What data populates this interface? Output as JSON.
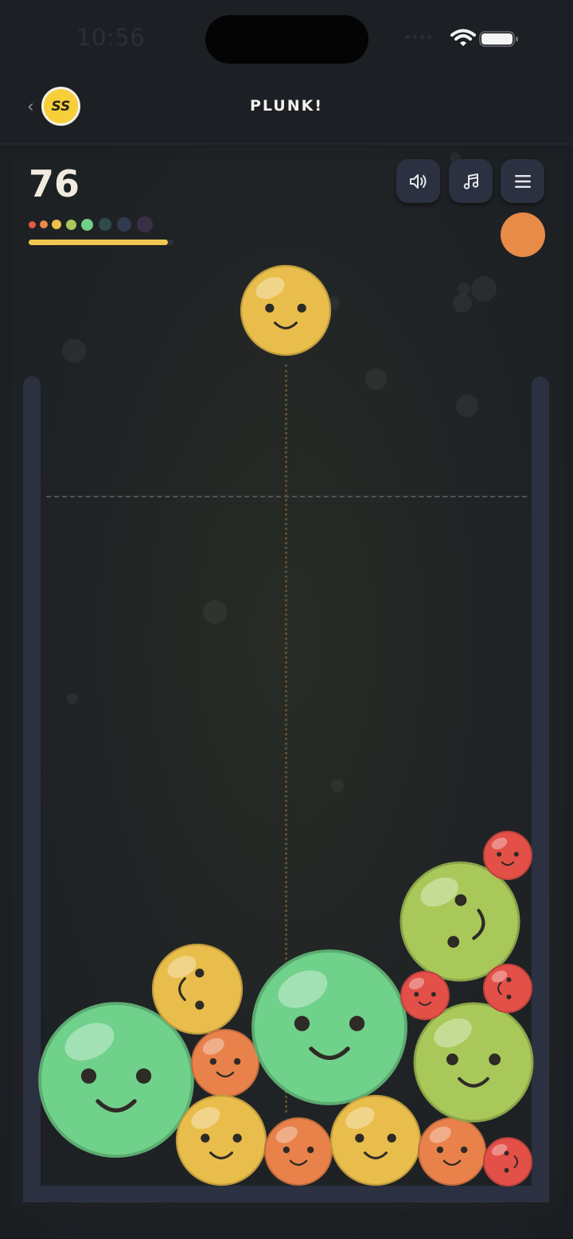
{
  "status_bar": {
    "time": "10:56",
    "icons": [
      "cellular-signal-icon",
      "wifi-icon",
      "battery-icon"
    ]
  },
  "header": {
    "back_icon": "‹",
    "avatar_initials": "SS",
    "title": "PLUNK!"
  },
  "hud": {
    "score": "76",
    "progress_fraction": 0.96,
    "tier_colors": [
      "#e35a45",
      "#e98a48",
      "#ecc04b",
      "#a9c75a",
      "#6fd087",
      "#2f4a4a",
      "#2f3a4f",
      "#3a3046"
    ],
    "buttons": {
      "sound_icon": "speaker-icon",
      "music_icon": "music-note-icon",
      "menu_icon": "hamburger-menu-icon"
    },
    "next_ball_color": "#e88a48"
  },
  "colors": {
    "red": "#e35048",
    "orange": "#e9824a",
    "yellow": "#e9bd4b",
    "lime": "#a8c859",
    "green": "#70d18a",
    "accent": "#f0c650",
    "wall": "#2b3140"
  },
  "pieces": {
    "held": {
      "color": "yellow"
    },
    "stack": [
      {
        "name": "green-ball-large-left",
        "color": "green"
      },
      {
        "name": "yellow-ball-upper-left",
        "color": "yellow"
      },
      {
        "name": "orange-ball-left",
        "color": "orange"
      },
      {
        "name": "yellow-ball-bottom-left",
        "color": "yellow"
      },
      {
        "name": "orange-ball-bottom",
        "color": "orange"
      },
      {
        "name": "green-ball-large-center",
        "color": "green"
      },
      {
        "name": "yellow-ball-bottom-center",
        "color": "yellow"
      },
      {
        "name": "orange-ball-bottom-right",
        "color": "orange"
      },
      {
        "name": "red-ball-bottom-right",
        "color": "red"
      },
      {
        "name": "lime-ball-right",
        "color": "lime"
      },
      {
        "name": "lime-ball-upper-right",
        "color": "lime"
      },
      {
        "name": "red-ball-middle",
        "color": "red"
      },
      {
        "name": "red-ball-right",
        "color": "red"
      },
      {
        "name": "red-ball-top-right",
        "color": "red"
      }
    ]
  }
}
